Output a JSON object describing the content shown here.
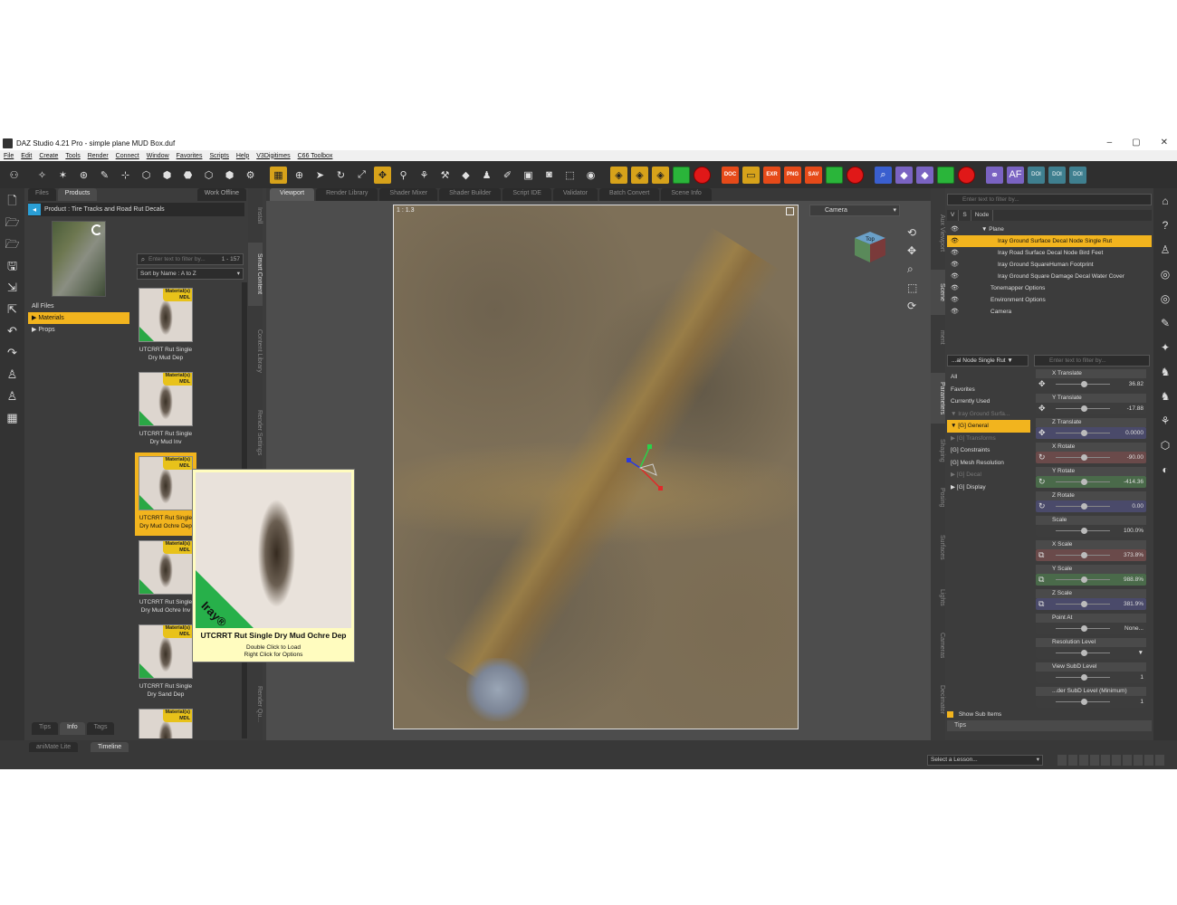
{
  "window": {
    "title": "DAZ Studio 4.21 Pro - simple plane MUD Box.duf",
    "minimize": "–",
    "maximize": "▢",
    "close": "✕"
  },
  "menu": [
    "File",
    "Edit",
    "Create",
    "Tools",
    "Render",
    "Connect",
    "Window",
    "Favorites",
    "Scripts",
    "Help",
    "V3Digitimes",
    "C66 Toolbox"
  ],
  "toolbar_icons": [
    "figure-icon",
    "transform-icon",
    "light-icon",
    "joint-icon",
    "node-icon",
    "surface-icon",
    "geometry-icon",
    "spot-render-icon",
    "camera-icon"
  ],
  "content_panel": {
    "tabs": [
      "Files",
      "Products"
    ],
    "active_tab": "Products",
    "work_offline": "Work Offline",
    "product_label": "Product : Tire Tracks and Road Rut Decals",
    "filter_placeholder": "Enter text to filter by...",
    "count": "1 - 157",
    "sort": "Sort by Name : A to Z",
    "tree": [
      {
        "label": "All Files",
        "selected": false
      },
      {
        "label": "▶ Materials",
        "selected": true
      },
      {
        "label": "▶ Props",
        "selected": false
      }
    ],
    "assets": [
      {
        "badge": "Material(s)\nMDL",
        "label": "UTCRRT Rut Single Dry Mud Dep",
        "selected": false
      },
      {
        "badge": "Material(s)\nMDL",
        "label": "UTCRRT Rut Single Dry Mud Inv",
        "selected": false
      },
      {
        "badge": "Material(s)\nMDL",
        "label": "UTCRRT Rut Single Dry Mud Ochre Dep",
        "selected": true
      },
      {
        "badge": "Material(s)\nMDL",
        "label": "UTCRRT Rut Single Dry Mud Ochre Inv",
        "selected": false
      },
      {
        "badge": "Material(s)\nMDL",
        "label": "UTCRRT Rut Single Dry Sand Dep",
        "selected": false
      },
      {
        "badge": "Material(s)\nMDL",
        "label": "",
        "selected": false
      }
    ],
    "bottom_tabs": [
      "Tips",
      "Info",
      "Tags"
    ],
    "active_bottom_tab": "Info",
    "side_tabs": [
      "Install",
      "Smart Content",
      "Content Library",
      "Render Settings",
      "Render Qu..."
    ]
  },
  "tooltip": {
    "title": "UTCRRT Rut Single Dry Mud Ochre Dep",
    "line1": "Double Click to Load",
    "line2": "Right Click for Options",
    "iray": "Iray®"
  },
  "viewport": {
    "tabs": [
      "Viewport",
      "Render Library",
      "Shader Mixer",
      "Shader Builder",
      "Script IDE",
      "Validator",
      "Batch Convert",
      "Scene Info"
    ],
    "active_tab": "Viewport",
    "coord": "1 : 1.3",
    "camera": "Camera",
    "navcube_label": "Top"
  },
  "scene": {
    "filter_placeholder": "Enter text to filter by...",
    "headers": [
      "V",
      "S",
      "Node"
    ],
    "rows": [
      {
        "label": "▼ Plane",
        "indent": 38,
        "selected": false
      },
      {
        "label": "Iray Ground Surface Decal Node Single Rut",
        "indent": 56,
        "selected": true
      },
      {
        "label": "Iray Road Surface Decal Node Bird Feet",
        "indent": 56,
        "selected": false
      },
      {
        "label": "Iray Ground SquareHuman Footprint",
        "indent": 56,
        "selected": false
      },
      {
        "label": "Iray Ground Square Damage Decal Water Cover",
        "indent": 56,
        "selected": false
      },
      {
        "label": "Tonemapper Options",
        "indent": 48,
        "selected": false
      },
      {
        "label": "Environment Options",
        "indent": 48,
        "selected": false
      },
      {
        "label": "Camera",
        "indent": 48,
        "selected": false
      }
    ],
    "side_tabs": [
      "Aux Viewport",
      "Scene",
      "ment"
    ]
  },
  "parameters": {
    "node_select": "...al Node Single Rut ▼",
    "filter_placeholder": "Enter text to filter by...",
    "tree": [
      {
        "label": "All",
        "cls": ""
      },
      {
        "label": "Favorites",
        "cls": ""
      },
      {
        "label": "Currently Used",
        "cls": ""
      },
      {
        "label": "▼ Iray Ground Surfa...",
        "cls": "dim"
      },
      {
        "label": "  ▼ [G] General",
        "cls": "sel"
      },
      {
        "label": "    ▶ [G] Transforms",
        "cls": "dim"
      },
      {
        "label": "      [G] Constraints",
        "cls": ""
      },
      {
        "label": "      [G] Mesh Resolution",
        "cls": ""
      },
      {
        "label": "  ▶ [G] Decal",
        "cls": "dim"
      },
      {
        "label": "  ▶ [G] Display",
        "cls": ""
      }
    ],
    "sliders": [
      {
        "name": "X Translate",
        "value": "36.82",
        "color": "#3d3d3d",
        "icon": "✥"
      },
      {
        "name": "Y Translate",
        "value": "-17.88",
        "color": "#3d3d3d",
        "icon": "✥"
      },
      {
        "name": "Z Translate",
        "value": "0.0000",
        "color": "#4a4a6a",
        "icon": "✥"
      },
      {
        "name": "X Rotate",
        "value": "-90.00",
        "color": "#6a4a4a",
        "icon": "↻"
      },
      {
        "name": "Y Rotate",
        "value": "-414.36",
        "color": "#4a6a4a",
        "icon": "↻"
      },
      {
        "name": "Z Rotate",
        "value": "0.00",
        "color": "#4a4a6a",
        "icon": "↻"
      },
      {
        "name": "Scale",
        "value": "100.0%",
        "color": "#3d3d3d",
        "icon": ""
      },
      {
        "name": "X Scale",
        "value": "373.8%",
        "color": "#6a4a4a",
        "icon": "⧉"
      },
      {
        "name": "Y Scale",
        "value": "988.8%",
        "color": "#4a6a4a",
        "icon": "⧉"
      },
      {
        "name": "Z Scale",
        "value": "381.9%",
        "color": "#4a4a6a",
        "icon": "⧉"
      },
      {
        "name": "Point At",
        "value": "None...",
        "color": "#3d3d3d",
        "icon": ""
      },
      {
        "name": "Resolution Level",
        "value": "▼",
        "color": "#3d3d3d",
        "icon": ""
      },
      {
        "name": "View SubD Level",
        "value": "1",
        "color": "#3d3d3d",
        "icon": ""
      },
      {
        "name": "...der SubD Level (Minimum)",
        "value": "1",
        "color": "#3d3d3d",
        "icon": ""
      }
    ],
    "show_sub_items": "Show Sub Items",
    "side_tabs": [
      "Parameters",
      "Shaping",
      "Posing",
      "Surfaces",
      "Lights",
      "Cameras",
      "Decimator"
    ],
    "tips": "Tips"
  },
  "statusbar": {
    "tabs": [
      "aniMate Lite",
      "Timeline"
    ],
    "lesson": "Select a Lesson..."
  }
}
